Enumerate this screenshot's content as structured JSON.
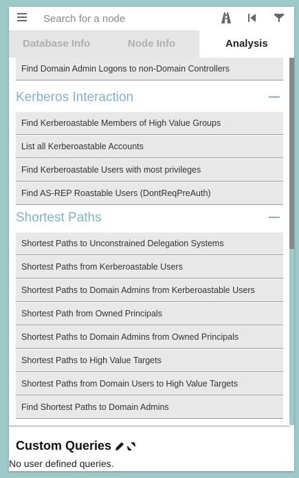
{
  "search": {
    "placeholder": "Search for a node"
  },
  "icons": {
    "menu": "menu-icon",
    "path": "pathfinding-icon",
    "back": "back-icon",
    "filter": "filter-icon"
  },
  "tabs": [
    {
      "label": "Database Info"
    },
    {
      "label": "Node Info"
    },
    {
      "label": "Analysis"
    }
  ],
  "active_tab": "Analysis",
  "partial_item": "Find Domain Admin Logons to non-Domain Controllers",
  "sections": [
    {
      "title": "Kerberos Interaction",
      "items": [
        "Find Kerberoastable Members of High Value Groups",
        "List all Kerberoastable Accounts",
        "Find Kerberoastable Users with most privileges",
        "Find AS-REP Roastable Users (DontReqPreAuth)"
      ]
    },
    {
      "title": "Shortest Paths",
      "items": [
        "Shortest Paths to Unconstrained Delegation Systems",
        "Shortest Paths from Kerberoastable Users",
        "Shortest Paths to Domain Admins from Kerberoastable Users",
        "Shortest Path from Owned Principals",
        "Shortest Paths to Domain Admins from Owned Principals",
        "Shortest Paths to High Value Targets",
        "Shortest Paths from Domain Users to High Value Targets",
        "Find Shortest Paths to Domain Admins"
      ]
    }
  ],
  "custom": {
    "title": "Custom Queries",
    "empty_text": "No user defined queries."
  },
  "colors": {
    "accent": "#7fb3cf",
    "background": "#9ec9c9"
  }
}
